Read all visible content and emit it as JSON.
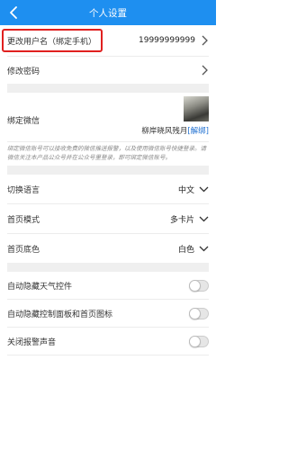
{
  "header": {
    "title": "个人设置",
    "back_icon": "chevron-left-icon"
  },
  "account": {
    "change_username_label": "更改用户名（绑定手机）",
    "phone_value": "19999999999",
    "change_password_label": "修改密码"
  },
  "wechat": {
    "label": "绑定微信",
    "nickname": "柳岸晓风残月",
    "unbind_label": "[解绑]",
    "note": "绑定微信账号可以接收免费的微信推送报警，以及使用微信账号快捷登录。请微信关注本产品公众号并在公众号里登录，即可绑定微信账号。"
  },
  "preferences": {
    "language_label": "切换语言",
    "language_value": "中文",
    "home_mode_label": "首页模式",
    "home_mode_value": "多卡片",
    "home_bg_label": "首页底色",
    "home_bg_value": "白色"
  },
  "toggles": [
    {
      "label": "自动隐藏天气控件",
      "on": false
    },
    {
      "label": "自动隐藏控制面板和首页图标",
      "on": false
    },
    {
      "label": "关闭报警声音",
      "on": false
    }
  ],
  "colors": {
    "header_bg": "#1e8ff0",
    "highlight_border": "#e0201f",
    "link": "#1e6fd0"
  }
}
